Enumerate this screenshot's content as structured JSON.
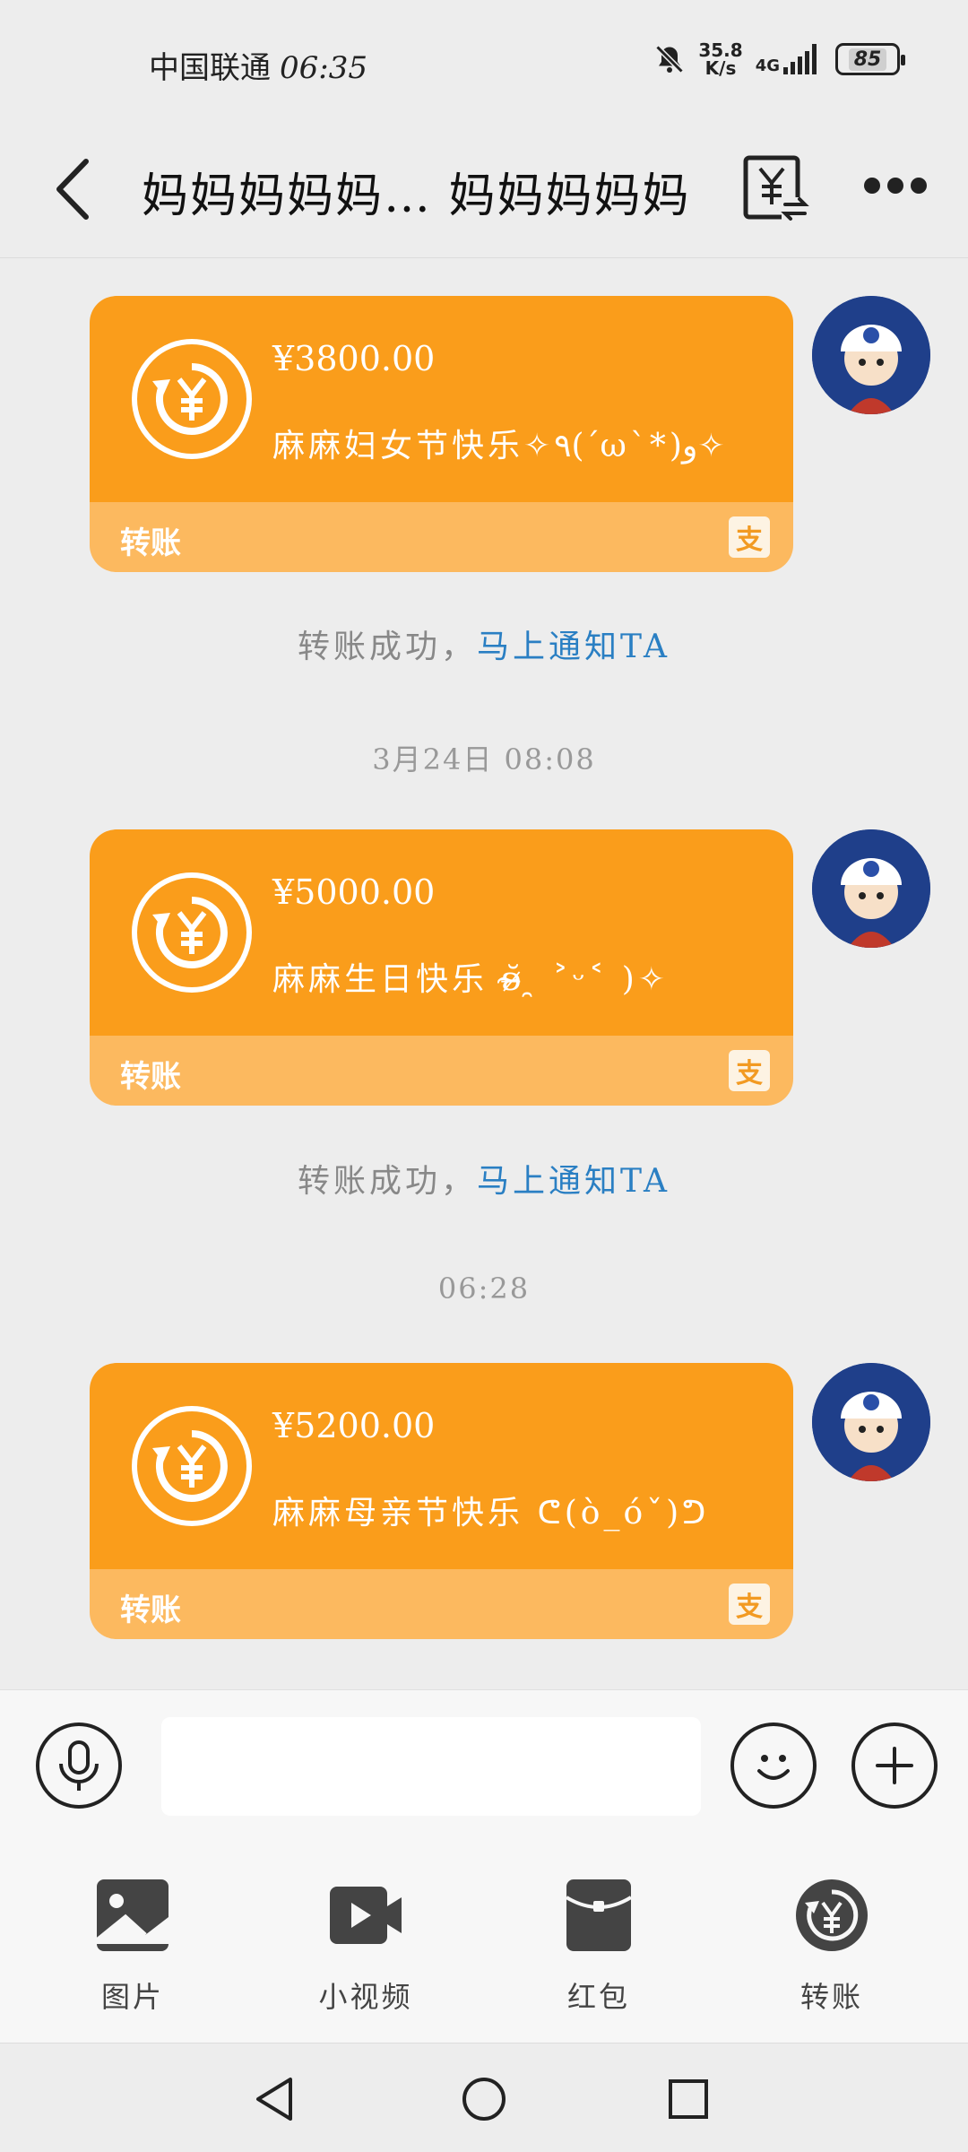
{
  "status_bar": {
    "carrier": "中国联通",
    "time": "06:35",
    "net_speed_value": "35.8",
    "net_speed_unit": "K/s",
    "network": "4G",
    "battery": "85",
    "icons": [
      "mute-bell-icon",
      "signal-icon",
      "battery-icon"
    ]
  },
  "header": {
    "title": "妈妈妈妈妈… 妈妈妈妈妈",
    "icons": [
      "back-arrow-icon",
      "transfer-record-icon",
      "more-icon"
    ]
  },
  "messages": [
    {
      "type": "transfer",
      "amount": "¥3800.00",
      "note": "麻麻妇女节快乐✧٩(ˊωˋ*)و✧",
      "footer_label": "转账",
      "status_text": "转账成功，",
      "status_link": "马上通知TA"
    },
    {
      "time_separator": "3月24日  08:08",
      "type": "transfer",
      "amount": "¥5000.00",
      "note": "麻麻生日快乐  ʚ̴̶̷̆ ̯ ˃ᵕ˂ )✧",
      "footer_label": "转账",
      "status_text": "转账成功，",
      "status_link": "马上通知TA"
    },
    {
      "time_separator": "06:28",
      "type": "transfer",
      "amount": "¥5200.00",
      "note": "麻麻母亲节快乐  ᕦ(ò_óˇ)ᕤ",
      "footer_label": "转账"
    }
  ],
  "input_bar": {
    "placeholder": "",
    "icons": [
      "microphone-icon",
      "emoji-icon",
      "plus-icon"
    ]
  },
  "tools": [
    {
      "label": "图片",
      "icon": "image-icon"
    },
    {
      "label": "小视频",
      "icon": "video-icon"
    },
    {
      "label": "红包",
      "icon": "red-packet-icon"
    },
    {
      "label": "转账",
      "icon": "transfer-icon"
    }
  ],
  "colors": {
    "card_orange": "#fa9d1b",
    "card_footer": "#fcb95f",
    "link_blue": "#2a7fc3",
    "background": "#ededed"
  }
}
